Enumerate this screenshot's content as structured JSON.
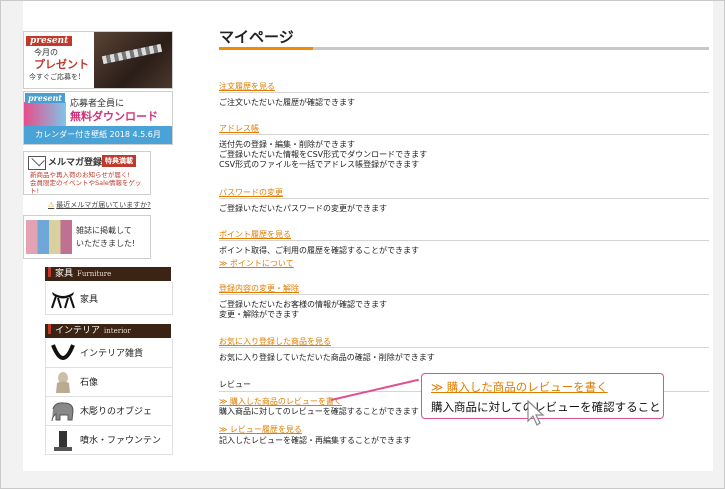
{
  "sidebar": {
    "present_banner": {
      "tag": "present",
      "line1": "今月の",
      "line2": "プレゼント",
      "line3": "今すぐご応募を!"
    },
    "download_banner": {
      "tag": "present",
      "line1": "応募者全員に",
      "line2": "無料ダウンロード",
      "footer": "カレンダー付き壁紙 2018 4.5.6月"
    },
    "mailmag_banner": {
      "title": "メルマガ登録",
      "badge": "特典満載",
      "text_line1": "新商品や再入荷のお知らせが届く!",
      "text_line2": "会員限定のイベントやSale情報をゲット!"
    },
    "mail_help_link": "最近メルマガ届いていますか?",
    "magazine_banner": {
      "line1": "雑誌に掲載して",
      "line2": "いただきました!"
    },
    "categories": [
      {
        "title": "家具",
        "title_en": "Furniture",
        "items": [
          {
            "label": "家具",
            "icon": "chair-icon"
          }
        ]
      },
      {
        "title": "インテリア",
        "title_en": "interior",
        "items": [
          {
            "label": "インテリア雑貨",
            "icon": "horseshoe-icon"
          },
          {
            "label": "石像",
            "icon": "statue-icon"
          },
          {
            "label": "木彫りのオブジェ",
            "icon": "elephant-icon"
          },
          {
            "label": "噴水・ファウンテン",
            "icon": "fountain-icon"
          }
        ]
      }
    ]
  },
  "main": {
    "title": "マイページ",
    "sections": [
      {
        "link": "注文履歴を見る",
        "desc": [
          "ご注文いただいた履歴が確認できます"
        ]
      },
      {
        "link": "アドレス帳",
        "desc": [
          "送付先の登録・編集・削除ができます",
          "ご登録いただいた情報をCSV形式でダウンロードできます",
          "CSV形式のファイルを一括でアドレス帳登録ができます"
        ]
      },
      {
        "link": "パスワードの変更",
        "desc": [
          "ご登録いただいたパスワードの変更ができます"
        ]
      },
      {
        "link": "ポイント履歴を見る",
        "desc": [
          "ポイント取得、ご利用の履歴を確認することができます"
        ],
        "sublink": "≫ ポイントについて"
      },
      {
        "link": "登録内容の変更・解除",
        "desc": [
          "ご登録いただいたお客様の情報が確認できます",
          "変更・解除ができます"
        ]
      },
      {
        "link": "お気に入り登録した商品を見る",
        "desc": [
          "お気に入り登録していただいた商品の確認・削除ができます"
        ]
      }
    ],
    "review": {
      "heading": "レビュー",
      "write_link": "≫ 購入した商品のレビューを書く",
      "write_desc": "購入商品に対してのレビューを確認することができます",
      "history_link": "≫ レビュー履歴を見る",
      "history_desc": "記入したレビューを確認・再編集することができます"
    },
    "callout": {
      "link": "≫ 購入した商品のレビューを書く",
      "text": "購入商品に対してのレビューを確認すること"
    }
  },
  "colors": {
    "accent": "#f08c00",
    "link": "#e07d00",
    "callout_border": "#e0508e",
    "category_header": "#3b2414"
  }
}
